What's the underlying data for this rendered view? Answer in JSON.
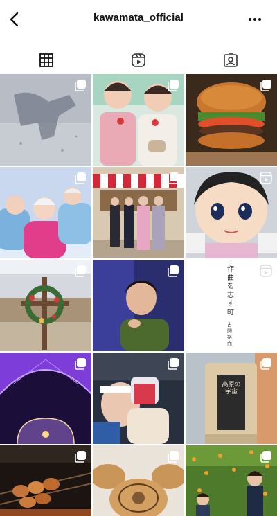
{
  "header": {
    "title": "kawamata_official",
    "back_icon": "chevron-left-icon",
    "more_icon": "more-horizontal-icon"
  },
  "tabs": [
    {
      "name": "posts",
      "icon": "grid-icon",
      "active": true
    },
    {
      "name": "reels",
      "icon": "reels-icon",
      "active": false
    },
    {
      "name": "tagged",
      "icon": "tagged-icon",
      "active": false
    }
  ],
  "posts": [
    {
      "subject": "shadow-on-snow",
      "badge": "carousel-icon"
    },
    {
      "subject": "girls-strawberries",
      "badge": "carousel-icon"
    },
    {
      "subject": "hamburger",
      "badge": "carousel-icon"
    },
    {
      "subject": "kids-in-snow",
      "badge": "carousel-icon"
    },
    {
      "subject": "kimono-group-photo",
      "badge": "carousel-icon"
    },
    {
      "subject": "mascot-character",
      "badge": "reels-icon"
    },
    {
      "subject": "wreath-cross",
      "badge": "carousel-icon"
    },
    {
      "subject": "child-in-blue-light",
      "badge": "carousel-icon"
    },
    {
      "subject": "text-card",
      "badge": "reels-icon",
      "text_column_1": "作曲を志す町",
      "text_column_2": "古関裕而"
    },
    {
      "subject": "purple-dome",
      "badge": "carousel-icon"
    },
    {
      "subject": "child-festival",
      "badge": "carousel-icon"
    },
    {
      "subject": "product-bag",
      "badge": "carousel-icon",
      "label_main": "高原の宇宙"
    },
    {
      "subject": "yakitori-grill",
      "badge": "carousel-icon"
    },
    {
      "subject": "stamped-buns",
      "badge": "carousel-icon"
    },
    {
      "subject": "kids-flower-field",
      "badge": "carousel-icon"
    }
  ]
}
